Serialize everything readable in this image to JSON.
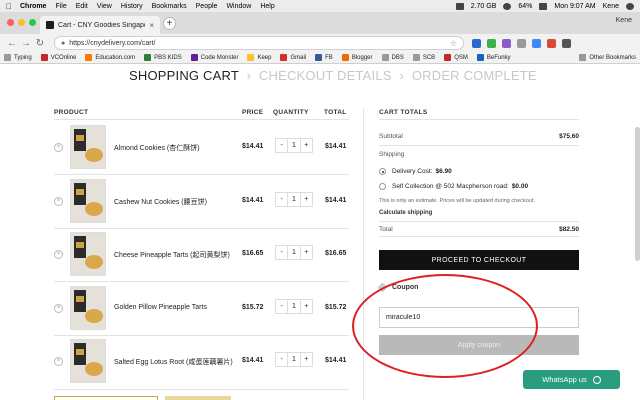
{
  "menubar": {
    "app": "Chrome",
    "items": [
      "File",
      "Edit",
      "View",
      "History",
      "Bookmarks",
      "People",
      "Window",
      "Help"
    ],
    "status": {
      "disk": "2.70 GB",
      "battery": "64%",
      "clock": "Mon 9:07 AM",
      "user": "Kene"
    }
  },
  "browser": {
    "tab_title": "Cart - CNY Goodies Singapore",
    "url": "https://cnydelivery.com/cart/",
    "profile": "Kene"
  },
  "bookmarks": [
    "Typing",
    "VCOnline",
    "Education.com",
    "PBS KIDS",
    "Code Monster",
    "Keep",
    "Gmail",
    "FB",
    "Blogger",
    "DBS",
    "SCB",
    "QSM",
    "BeFunky"
  ],
  "bookmarks_other": "Other Bookmarks",
  "steps": {
    "cart": "SHOPPING CART",
    "details": "CHECKOUT DETAILS",
    "complete": "ORDER COMPLETE",
    "sep": "›"
  },
  "cart": {
    "headers": {
      "product": "PRODUCT",
      "price": "PRICE",
      "quantity": "QUANTITY",
      "total": "TOTAL"
    },
    "items": [
      {
        "name": "Almond Cookies (杏仁酥饼)",
        "price": "$14.41",
        "qty": "1",
        "total": "$14.41"
      },
      {
        "name": "Cashew Nut Cookies (腰豆饼)",
        "price": "$14.41",
        "qty": "1",
        "total": "$14.41"
      },
      {
        "name": "Cheese Pineapple Tarts (起司黄梨饼)",
        "price": "$16.65",
        "qty": "1",
        "total": "$16.65"
      },
      {
        "name": "Golden Pillow Pineapple Tarts",
        "price": "$15.72",
        "qty": "1",
        "total": "$15.72"
      },
      {
        "name": "Salted Egg Lotus Root (咸蛋莲藕薯片)",
        "price": "$14.41",
        "qty": "1",
        "total": "$14.41"
      }
    ],
    "minus": "-",
    "plus": "+",
    "remove": "×"
  },
  "totals": {
    "header": "CART TOTALS",
    "subtotal_label": "Subtotal",
    "subtotal": "$75.60",
    "shipping_label": "Shipping",
    "delivery_label": "Delivery Cost:",
    "delivery_value": "$6.90",
    "self_label": "Self Collection @ 502 Macpherson road:",
    "self_value": "$0.00",
    "note": "This is only an estimate. Prices will be updated during checkout.",
    "calc": "Calculate shipping",
    "total_label": "Total",
    "total": "$82.50",
    "checkout_btn": "PROCEED TO CHECKOUT",
    "coupon_label": "Coupon",
    "coupon_value": "miracule10",
    "apply_btn": "Apply coupon"
  },
  "whatsapp": "WhatsApp us",
  "colors": {
    "accent_dark": "#111111",
    "whatsapp": "#2a9d7e",
    "annotation": "#e02020",
    "step_inactive": "#c8c8c8"
  }
}
